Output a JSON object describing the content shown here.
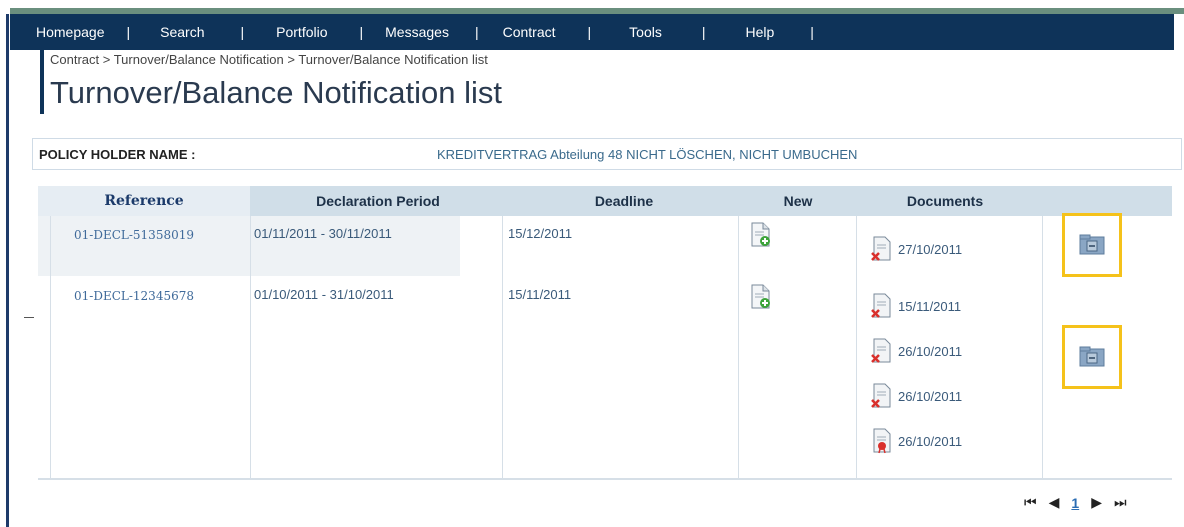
{
  "nav": {
    "items": [
      {
        "label": "Homepage"
      },
      {
        "label": "Search"
      },
      {
        "label": "Portfolio"
      },
      {
        "label": "Messages"
      },
      {
        "label": "Contract"
      },
      {
        "label": "Tools"
      },
      {
        "label": "Help"
      }
    ],
    "separator": "|"
  },
  "breadcrumb": "Contract > Turnover/Balance Notification > Turnover/Balance Notification list",
  "title": "Turnover/Balance Notification list",
  "policy": {
    "label": "POLICY HOLDER NAME :",
    "value": "KREDITVERTRAG Abteilung 48 NICHT LÖSCHEN, NICHT UMBUCHEN"
  },
  "table": {
    "headers": {
      "reference": "Reference",
      "period": "Declaration Period",
      "deadline": "Deadline",
      "new": "New",
      "documents": "Documents"
    },
    "rows": [
      {
        "reference": "01-DECL-51358019",
        "period": "01/11/2011 - 30/11/2011",
        "deadline": "15/12/2011",
        "documents": [
          {
            "date": "27/10/2011",
            "icon": "document-delete-icon"
          }
        ]
      },
      {
        "reference": "01-DECL-12345678",
        "period": "01/10/2011 - 31/10/2011",
        "deadline": "15/11/2011",
        "documents": [
          {
            "date": "15/11/2011",
            "icon": "document-delete-icon"
          },
          {
            "date": "26/10/2011",
            "icon": "document-delete-icon"
          },
          {
            "date": "26/10/2011",
            "icon": "document-delete-icon"
          },
          {
            "date": "26/10/2011",
            "icon": "document-certificate-icon"
          }
        ]
      }
    ]
  },
  "pager": {
    "first": "⏮",
    "prev": "◀",
    "current": "1",
    "next": "▶",
    "last": "⏭"
  },
  "colors": {
    "navbar": "#0e3359",
    "header": "#d0dee8",
    "highlight": "#f5c21a"
  }
}
